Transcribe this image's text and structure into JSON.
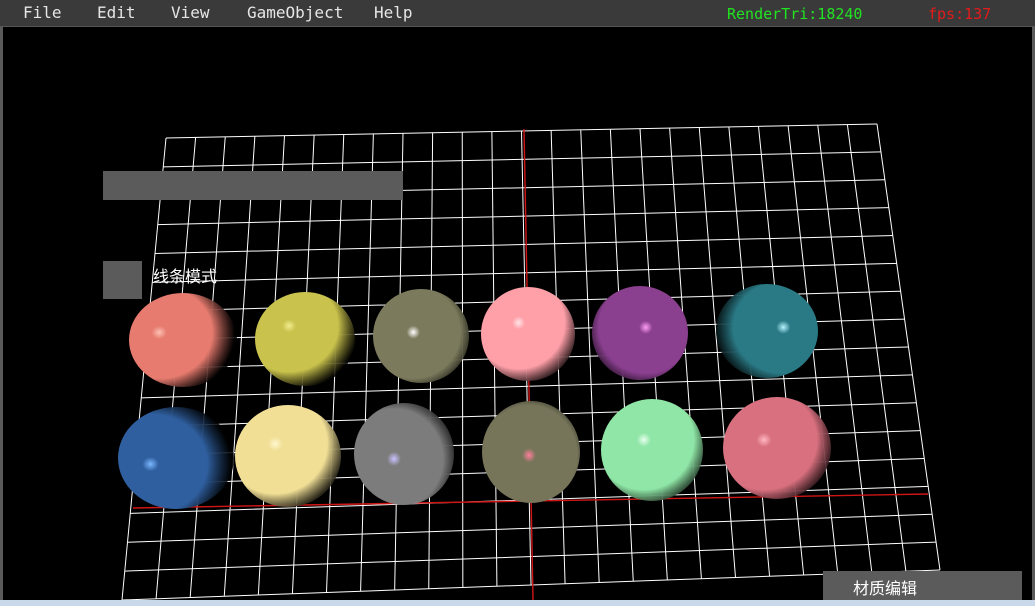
{
  "menu": {
    "items": [
      {
        "label": "File"
      },
      {
        "label": "Edit"
      },
      {
        "label": "View"
      },
      {
        "label": "GameObject"
      },
      {
        "label": "Help"
      }
    ]
  },
  "stats": {
    "render_tri": "RenderTri:18240",
    "fps": "fps:137",
    "render_tri_color": "#22e322",
    "fps_color": "#e31b1b"
  },
  "panel": {
    "wire_mode_label": "线条模式",
    "material_button_label": "材质编辑"
  },
  "scene": {
    "spheres": [
      {
        "color": "#e77b6f",
        "highlight": "#ffc0b5"
      },
      {
        "color": "#c9c24c",
        "highlight": "#f2ec8e"
      },
      {
        "color": "#7b7a5c",
        "highlight": "#ffffff"
      },
      {
        "color": "#ff9fa8",
        "highlight": "#ffe5e8"
      },
      {
        "color": "#8a3f8f",
        "highlight": "#ff9ef5"
      },
      {
        "color": "#2a7a86",
        "highlight": "#b6f4ff"
      },
      {
        "color": "#2f5f9f",
        "highlight": "#7ab8ff"
      },
      {
        "color": "#f1df96",
        "highlight": "#fff8cf"
      },
      {
        "color": "#7c7c7c",
        "highlight": "#c9c2ff"
      },
      {
        "color": "#76755a",
        "highlight": "#ff7f9a"
      },
      {
        "color": "#8fe6a6",
        "highlight": "#e8ffef"
      },
      {
        "color": "#d9707f",
        "highlight": "#ffb8c2"
      }
    ],
    "grid_color": "#ffffff",
    "axis_color": "#d01515"
  }
}
